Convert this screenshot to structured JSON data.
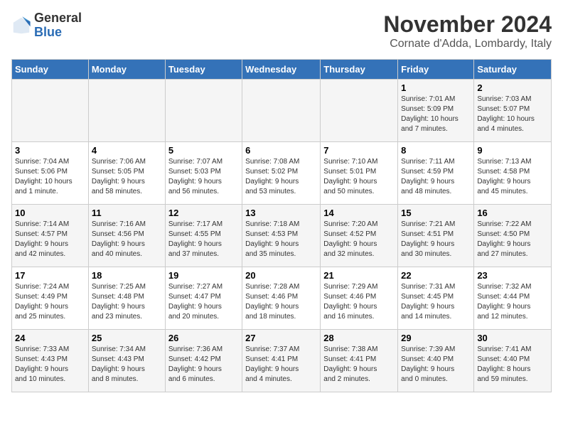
{
  "header": {
    "logo_general": "General",
    "logo_blue": "Blue",
    "month": "November 2024",
    "location": "Cornate d'Adda, Lombardy, Italy"
  },
  "days_of_week": [
    "Sunday",
    "Monday",
    "Tuesday",
    "Wednesday",
    "Thursday",
    "Friday",
    "Saturday"
  ],
  "weeks": [
    [
      {
        "day": "",
        "info": ""
      },
      {
        "day": "",
        "info": ""
      },
      {
        "day": "",
        "info": ""
      },
      {
        "day": "",
        "info": ""
      },
      {
        "day": "",
        "info": ""
      },
      {
        "day": "1",
        "info": "Sunrise: 7:01 AM\nSunset: 5:09 PM\nDaylight: 10 hours\nand 7 minutes."
      },
      {
        "day": "2",
        "info": "Sunrise: 7:03 AM\nSunset: 5:07 PM\nDaylight: 10 hours\nand 4 minutes."
      }
    ],
    [
      {
        "day": "3",
        "info": "Sunrise: 7:04 AM\nSunset: 5:06 PM\nDaylight: 10 hours\nand 1 minute."
      },
      {
        "day": "4",
        "info": "Sunrise: 7:06 AM\nSunset: 5:05 PM\nDaylight: 9 hours\nand 58 minutes."
      },
      {
        "day": "5",
        "info": "Sunrise: 7:07 AM\nSunset: 5:03 PM\nDaylight: 9 hours\nand 56 minutes."
      },
      {
        "day": "6",
        "info": "Sunrise: 7:08 AM\nSunset: 5:02 PM\nDaylight: 9 hours\nand 53 minutes."
      },
      {
        "day": "7",
        "info": "Sunrise: 7:10 AM\nSunset: 5:01 PM\nDaylight: 9 hours\nand 50 minutes."
      },
      {
        "day": "8",
        "info": "Sunrise: 7:11 AM\nSunset: 4:59 PM\nDaylight: 9 hours\nand 48 minutes."
      },
      {
        "day": "9",
        "info": "Sunrise: 7:13 AM\nSunset: 4:58 PM\nDaylight: 9 hours\nand 45 minutes."
      }
    ],
    [
      {
        "day": "10",
        "info": "Sunrise: 7:14 AM\nSunset: 4:57 PM\nDaylight: 9 hours\nand 42 minutes."
      },
      {
        "day": "11",
        "info": "Sunrise: 7:16 AM\nSunset: 4:56 PM\nDaylight: 9 hours\nand 40 minutes."
      },
      {
        "day": "12",
        "info": "Sunrise: 7:17 AM\nSunset: 4:55 PM\nDaylight: 9 hours\nand 37 minutes."
      },
      {
        "day": "13",
        "info": "Sunrise: 7:18 AM\nSunset: 4:53 PM\nDaylight: 9 hours\nand 35 minutes."
      },
      {
        "day": "14",
        "info": "Sunrise: 7:20 AM\nSunset: 4:52 PM\nDaylight: 9 hours\nand 32 minutes."
      },
      {
        "day": "15",
        "info": "Sunrise: 7:21 AM\nSunset: 4:51 PM\nDaylight: 9 hours\nand 30 minutes."
      },
      {
        "day": "16",
        "info": "Sunrise: 7:22 AM\nSunset: 4:50 PM\nDaylight: 9 hours\nand 27 minutes."
      }
    ],
    [
      {
        "day": "17",
        "info": "Sunrise: 7:24 AM\nSunset: 4:49 PM\nDaylight: 9 hours\nand 25 minutes."
      },
      {
        "day": "18",
        "info": "Sunrise: 7:25 AM\nSunset: 4:48 PM\nDaylight: 9 hours\nand 23 minutes."
      },
      {
        "day": "19",
        "info": "Sunrise: 7:27 AM\nSunset: 4:47 PM\nDaylight: 9 hours\nand 20 minutes."
      },
      {
        "day": "20",
        "info": "Sunrise: 7:28 AM\nSunset: 4:46 PM\nDaylight: 9 hours\nand 18 minutes."
      },
      {
        "day": "21",
        "info": "Sunrise: 7:29 AM\nSunset: 4:46 PM\nDaylight: 9 hours\nand 16 minutes."
      },
      {
        "day": "22",
        "info": "Sunrise: 7:31 AM\nSunset: 4:45 PM\nDaylight: 9 hours\nand 14 minutes."
      },
      {
        "day": "23",
        "info": "Sunrise: 7:32 AM\nSunset: 4:44 PM\nDaylight: 9 hours\nand 12 minutes."
      }
    ],
    [
      {
        "day": "24",
        "info": "Sunrise: 7:33 AM\nSunset: 4:43 PM\nDaylight: 9 hours\nand 10 minutes."
      },
      {
        "day": "25",
        "info": "Sunrise: 7:34 AM\nSunset: 4:43 PM\nDaylight: 9 hours\nand 8 minutes."
      },
      {
        "day": "26",
        "info": "Sunrise: 7:36 AM\nSunset: 4:42 PM\nDaylight: 9 hours\nand 6 minutes."
      },
      {
        "day": "27",
        "info": "Sunrise: 7:37 AM\nSunset: 4:41 PM\nDaylight: 9 hours\nand 4 minutes."
      },
      {
        "day": "28",
        "info": "Sunrise: 7:38 AM\nSunset: 4:41 PM\nDaylight: 9 hours\nand 2 minutes."
      },
      {
        "day": "29",
        "info": "Sunrise: 7:39 AM\nSunset: 4:40 PM\nDaylight: 9 hours\nand 0 minutes."
      },
      {
        "day": "30",
        "info": "Sunrise: 7:41 AM\nSunset: 4:40 PM\nDaylight: 8 hours\nand 59 minutes."
      }
    ]
  ]
}
